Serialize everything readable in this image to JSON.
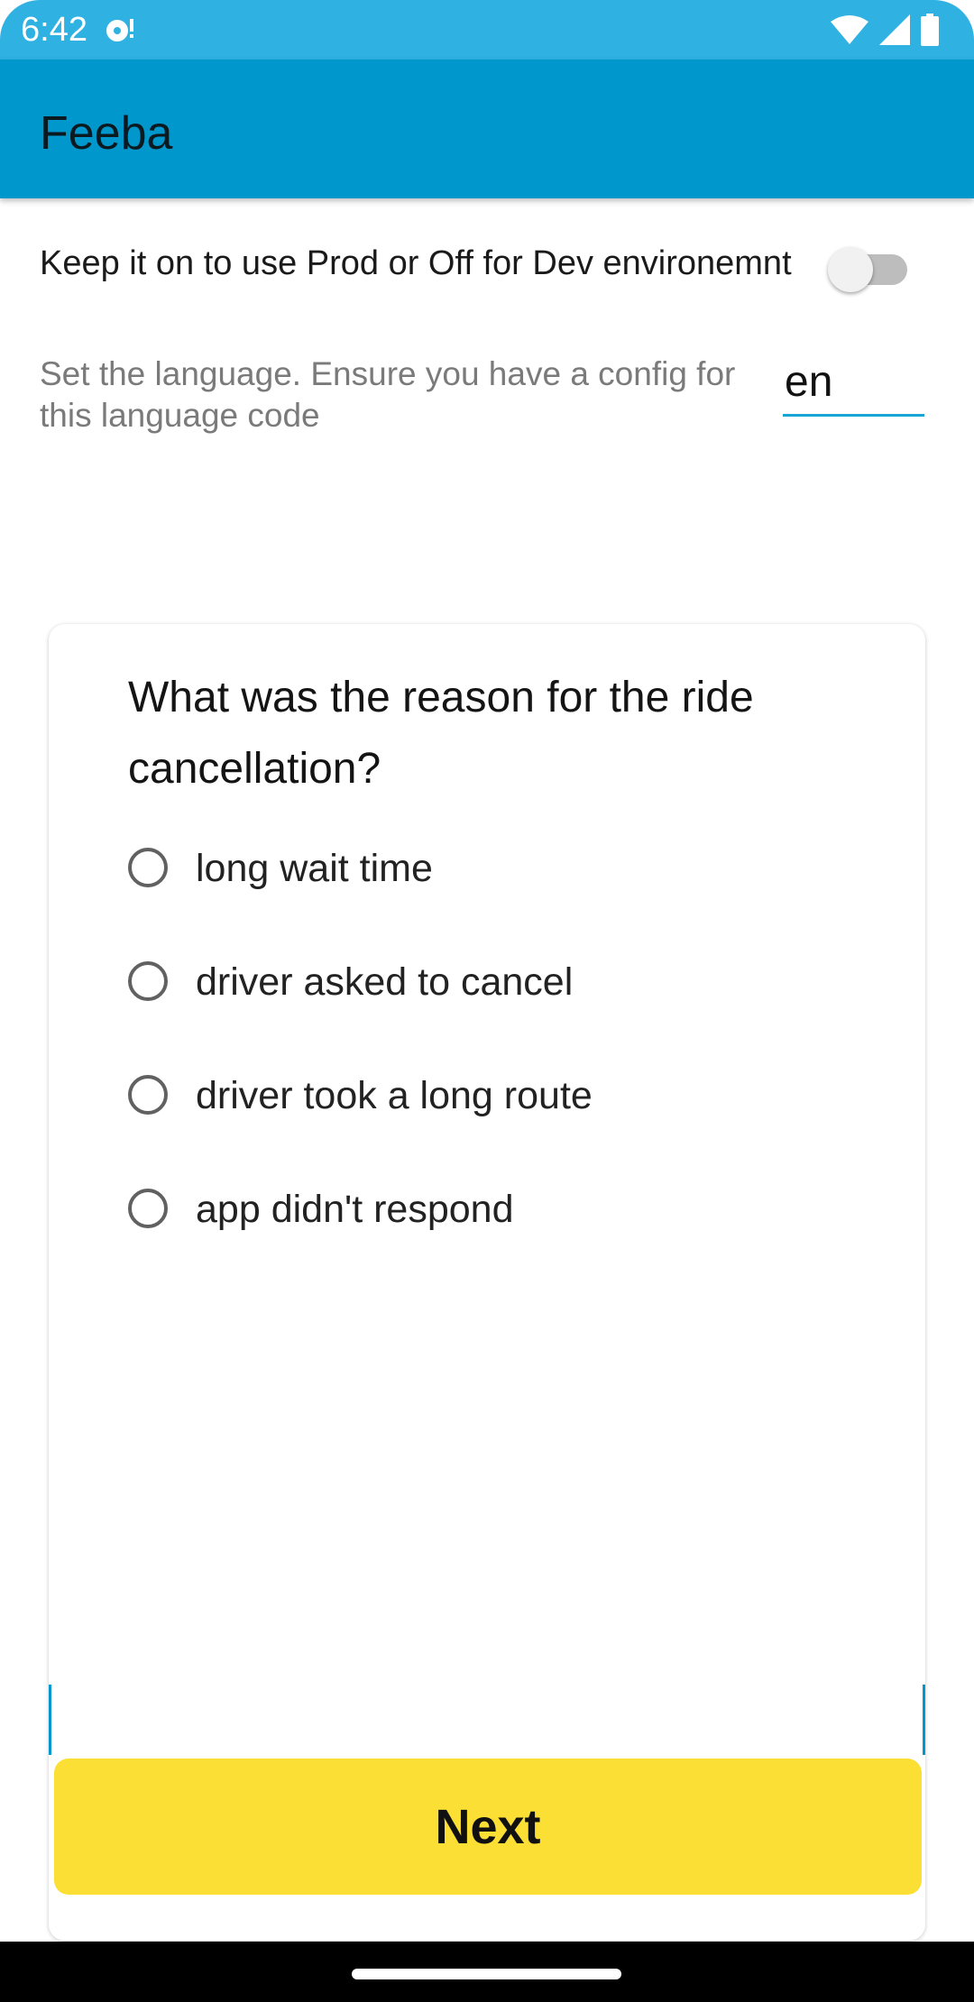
{
  "status_bar": {
    "time": "6:42",
    "icons": [
      "notification-icon",
      "wifi-icon",
      "signal-icon",
      "battery-icon"
    ]
  },
  "app_bar": {
    "title": "Feeba"
  },
  "settings": {
    "env_toggle": {
      "label": "Keep it on to use Prod or Off for Dev environemnt",
      "on": false
    },
    "language": {
      "label": "Set the language. Ensure you have a config for this language code",
      "value": "en"
    }
  },
  "survey": {
    "question": "What was the reason for the ride cancellation?",
    "options": [
      {
        "label": "long wait time"
      },
      {
        "label": "driver asked to cancel"
      },
      {
        "label": "driver took a long route"
      },
      {
        "label": "app didn't respond"
      }
    ],
    "next_label": "Next"
  },
  "colors": {
    "status_bar": "#2fb1e2",
    "app_bar": "#0098cc",
    "next_button": "#fbdf35",
    "input_underline": "#1aa3d6"
  }
}
